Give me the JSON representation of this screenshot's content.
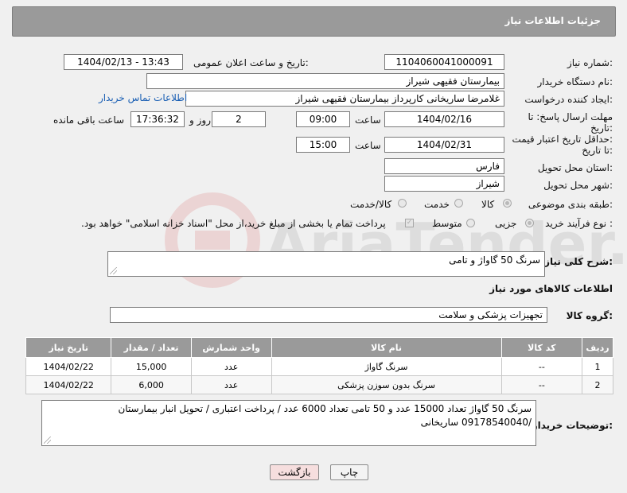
{
  "header": {
    "title": "جزئیات اطلاعات نیاز"
  },
  "fields": {
    "need_number_label": "شماره نیاز:",
    "need_number": "1104060041000091",
    "announce_label": "تاریخ و ساعت اعلان عمومی:",
    "announce_value": "1404/02/13 - 13:43",
    "buyer_org_label": "نام دستگاه خریدار:",
    "buyer_org": "بیمارستان فقیهی شیراز",
    "requester_label": "ایجاد کننده درخواست:",
    "requester": "غلامرضا ساریخانی کارپرداز بیمارستان فقیهی شیراز",
    "contact_link": "اطلاعات تماس خریدار",
    "deadline_label_1": "مهلت ارسال پاسخ: تا",
    "deadline_label_2": "تاریخ:",
    "deadline_date": "1404/02/16",
    "time_label": "ساعت",
    "deadline_time": "09:00",
    "days_value": "2",
    "days_label": "روز و",
    "remaining_time": "17:36:32",
    "remaining_label": "ساعت باقی مانده",
    "validity_label_1": "حداقل تاریخ اعتبار قیمت:",
    "validity_label_2": "تا تاریخ:",
    "validity_date": "1404/02/31",
    "validity_time_label": "ساعت",
    "validity_time": "15:00",
    "province_label": "استان محل تحویل:",
    "province": "فارس",
    "city_label": "شهر محل تحویل:",
    "city": "شیراز",
    "category_label": "طبقه بندی موضوعی:",
    "category_options": [
      "کالا",
      "خدمت",
      "کالا/خدمت"
    ],
    "purchase_type_label": "نوع فرآیند خرید :",
    "purchase_type_options": [
      "جزیی",
      "متوسط"
    ],
    "payment_note": "پرداخت تمام یا بخشی از مبلغ خرید،از محل \"اسناد خزانه اسلامی\" خواهد بود.",
    "summary_label": "شرح کلی نیاز:",
    "summary": "سرنگ 50 گاواژ و تامی",
    "items_heading": "اطلاعات کالاهای مورد نیاز",
    "group_label": "گروه کالا:",
    "group_value": "تجهیزات پزشکی و سلامت",
    "buyer_notes_label": "توضیحات خریدار:",
    "buyer_notes": "سرنگ 50 گاواژ تعداد 15000 عدد و 50 تامی تعداد 6000 عدد / پرداخت اعتباری / تحویل انبار بیمارستان /09178540040 ساریخانی"
  },
  "table": {
    "headers": [
      "ردیف",
      "کد کالا",
      "نام کالا",
      "واحد شمارش",
      "تعداد / مقدار",
      "تاریخ نیاز"
    ],
    "rows": [
      [
        "1",
        "--",
        "سرنگ گاواژ",
        "عدد",
        "15,000",
        "1404/02/22"
      ],
      [
        "2",
        "--",
        "سرنگ بدون سوزن پزشکی",
        "عدد",
        "6,000",
        "1404/02/22"
      ]
    ]
  },
  "buttons": {
    "print": "چاپ",
    "back": "بازگشت"
  },
  "watermark": {
    "text": "AriaTender.neT"
  },
  "colors": {
    "header_bg": "#9a9a9a",
    "link": "#1a5fb4",
    "back_button_bg": "#f6dede"
  }
}
